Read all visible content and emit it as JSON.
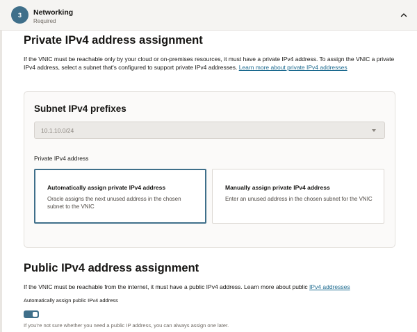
{
  "step": {
    "number": "3",
    "title": "Networking",
    "subtitle": "Required"
  },
  "private": {
    "heading": "Private IPv4 address assignment",
    "description": "If the VNIC must be reachable only by your cloud or on-premises resources, it must have a private IPv4 address. To assign the VNIC a private IPv4 address, select a subnet that's configured to support private IPv4 addresses. ",
    "learn_more": "Learn more about private IPv4 addresses",
    "card": {
      "title": "Subnet IPv4 prefixes",
      "select_value": "10.1.10.0/24",
      "field_label": "Private IPv4 address",
      "options": [
        {
          "title": "Automatically assign private IPv4 address",
          "description": "Oracle assigns the next unused address in the chosen subnet to the VNIC",
          "selected": true
        },
        {
          "title": "Manually assign private IPv4 address",
          "description": "Enter an unused address in the chosen subnet for the VNIC",
          "selected": false
        }
      ]
    }
  },
  "public": {
    "heading": "Public IPv4 address assignment",
    "description": "If the VNIC must be reachable from the internet, it must have a public IPv4 address. Learn more about public ",
    "link": "IPv4 addresses",
    "toggle_label": "Automatically assign public IPv4 address",
    "toggle_on": true,
    "hint": "If you're not sure whether you need a public IP address, you can always assign one later."
  },
  "colors": {
    "accent": "#3f6f8a",
    "link": "#1b6a8f"
  }
}
